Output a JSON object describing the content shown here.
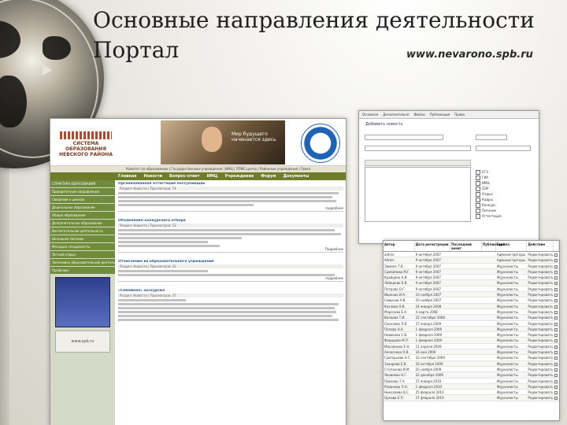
{
  "slide": {
    "title_line1": "Основные направления деятельности",
    "title_line2": "Портал",
    "url": "www.nevarono.spb.ru"
  },
  "portal": {
    "logo_text": "СИСТЕМА ОБРАЗОВАНИЯ НЕВСКОГО РАЙОНА",
    "slogan": "Мир будущего начинается здесь",
    "nav_text": "Комитет по образованию | Государственные учреждения | ИМЦ | ППМС-центр | Районные учреждения | Поиск",
    "menu": [
      "Главная",
      "Новости",
      "Вопрос-ответ",
      "ИМЦ",
      "Учреждения",
      "Форум",
      "Документы"
    ],
    "sidebar": [
      "СТРУКТУРА ОБРАЗОВАНИЯ",
      "Приоритетные направления",
      "Сведения о школах",
      "Дошкольное образование",
      "Общее образование",
      "Дополнительное образование",
      "Воспитательная деятельность",
      "Школьное питание",
      "Молодые специалисты",
      "Летний отдых",
      "Экономика образовательной деятельности",
      "Профсоюз"
    ],
    "sidebar_banner2": "www.spb.ru",
    "news": [
      {
        "title": "Организованная аттестация поступающих",
        "meta": "Раздел: Новости | Просмотров: 74",
        "more": "подробнее"
      },
      {
        "title": "Объявление конкурсного отбора",
        "meta": "Раздел: Новости | Просмотров: 53",
        "more": "Подробнее"
      },
      {
        "title": "Отчисление из образовательного учреждения",
        "meta": "Раздел: Новости | Просмотров: 41",
        "more": "подробнее"
      },
      {
        "title": "«Семейная» экскурсия",
        "meta": "Раздел: Новости | Просмотров: 37",
        "more": "подробнее"
      }
    ]
  },
  "form": {
    "tabs": [
      "Основное",
      "Дополнительно",
      "Файлы",
      "Публикация",
      "Права"
    ],
    "title": "Добавить новость",
    "options": [
      "ЕГЭ",
      "ГИА",
      "ИМЦ",
      "ОЭР",
      "Отдых",
      "Кадры",
      "Конкурс",
      "Питание",
      "Аттестация"
    ]
  },
  "table": {
    "headers": [
      "Автор",
      "Дата регистрации",
      "Последний визит",
      "Публикаций",
      "Группа",
      "Действие",
      ""
    ],
    "rows": [
      [
        "admin",
        "9 октября 2007",
        "",
        "",
        "Администраторы",
        "Редактировать"
      ],
      [
        "Admin",
        "9 октября 2007",
        "",
        "",
        "Администраторы",
        "Редактировать"
      ],
      [
        "Зимина Т.В.",
        "9 октября 2007",
        "",
        "",
        "Журналисты",
        "Редактировать"
      ],
      [
        "Самойлова М.Г.",
        "9 октября 2007",
        "",
        "",
        "Журналисты",
        "Редактировать"
      ],
      [
        "Кравцова А.И.",
        "9 октября 2007",
        "",
        "",
        "Журналисты",
        "Редактировать"
      ],
      [
        "Лебедева Е.В.",
        "9 октября 2007",
        "",
        "",
        "Журналисты",
        "Редактировать"
      ],
      [
        "Петрова О.Г.",
        "9 октября 2007",
        "",
        "",
        "Журналисты",
        "Редактировать"
      ],
      [
        "Иванова И.А.",
        "10 ноября 2007",
        "",
        "",
        "Журналисты",
        "Редактировать"
      ],
      [
        "Смирнов А.В.",
        "10 ноября 2007",
        "",
        "",
        "Журналисты",
        "Редактировать"
      ],
      [
        "Козлова Н.В.",
        "24 января 2008",
        "",
        "",
        "Журналисты",
        "Редактировать"
      ],
      [
        "Морозова Е.А.",
        "4 марта 2008",
        "",
        "",
        "Журналисты",
        "Редактировать"
      ],
      [
        "Волкова Т.И.",
        "22 сентября 2008",
        "",
        "",
        "Журналисты",
        "Редактировать"
      ],
      [
        "Соколова Л.В.",
        "27 января 2009",
        "",
        "",
        "Журналисты",
        "Редактировать"
      ],
      [
        "Попова Н.А.",
        "1 февраля 2009",
        "",
        "",
        "Журналисты",
        "Редактировать"
      ],
      [
        "Новикова С.В.",
        "1 февраля 2009",
        "",
        "",
        "Журналисты",
        "Редактировать"
      ],
      [
        "Федорова М.П.",
        "1 февраля 2009",
        "",
        "",
        "Журналисты",
        "Редактировать"
      ],
      [
        "Михайлова Е.Н.",
        "11 апреля 2009",
        "",
        "",
        "Журналисты",
        "Редактировать"
      ],
      [
        "Алексеева О.В.",
        "16 мая 2009",
        "",
        "",
        "Журналисты",
        "Редактировать"
      ],
      [
        "Григорьева А.С.",
        "23 сентября 2009",
        "",
        "",
        "Журналисты",
        "Редактировать"
      ],
      [
        "Захарова Е.В.",
        "10 октября 2009",
        "",
        "",
        "Журналисты",
        "Редактировать"
      ],
      [
        "Степанова И.М.",
        "25 ноября 2009",
        "",
        "",
        "Журналисты",
        "Редактировать"
      ],
      [
        "Яковлева Н.Г.",
        "22 декабря 2009",
        "",
        "",
        "Журналисты",
        "Редактировать"
      ],
      [
        "Павлова Т.А.",
        "27 января 2010",
        "",
        "",
        "Журналисты",
        "Редактировать"
      ],
      [
        "Романова Л.Н.",
        "1 февраля 2010",
        "",
        "",
        "Журналисты",
        "Редактировать"
      ],
      [
        "Николаева В.С.",
        "25 февраля 2010",
        "",
        "",
        "Журналисты",
        "Редактировать"
      ],
      [
        "Орлова Е.П.",
        "27 февраля 2010",
        "",
        "",
        "Журналисты",
        "Редактировать"
      ]
    ]
  }
}
